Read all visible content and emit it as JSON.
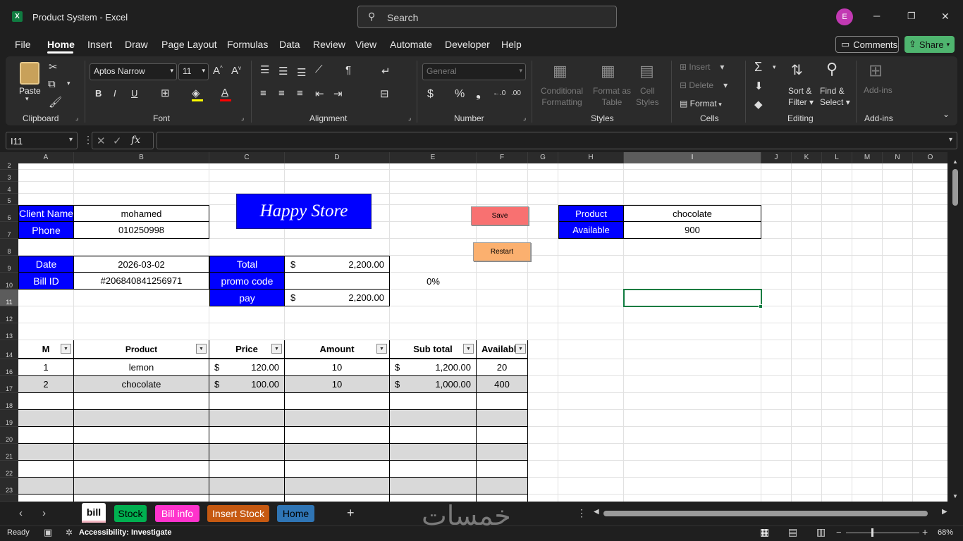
{
  "app": {
    "title": "Product System",
    "app_name": "Excel",
    "search_placeholder": "Search",
    "user_initial": "E"
  },
  "window_controls": {
    "minimize": "─",
    "restore": "❐",
    "close": "✕"
  },
  "menu": [
    "File",
    "Home",
    "Insert",
    "Draw",
    "Page Layout",
    "Formulas",
    "Data",
    "Review",
    "View",
    "Automate",
    "Developer",
    "Help"
  ],
  "actions": {
    "comments": "Comments",
    "share": "Share"
  },
  "ribbon": {
    "clipboard": {
      "paste": "Paste",
      "label": "Clipboard"
    },
    "font": {
      "name": "Aptos Narrow",
      "size": "11",
      "bold": "B",
      "italic": "I",
      "underline": "U",
      "label": "Font"
    },
    "alignment": {
      "label": "Alignment"
    },
    "number": {
      "format": "General",
      "currency": "$",
      "percent": "%",
      "comma": "❟",
      "label": "Number"
    },
    "styles": {
      "conditional_1": "Conditional",
      "conditional_2": "Formatting",
      "format_as_1": "Format as",
      "format_as_2": "Table",
      "cell_1": "Cell",
      "cell_2": "Styles",
      "label": "Styles"
    },
    "cells": {
      "insert": "Insert",
      "delete": "Delete",
      "format": "Format",
      "label": "Cells"
    },
    "editing": {
      "sort_1": "Sort &",
      "sort_2": "Filter",
      "find_1": "Find &",
      "find_2": "Select",
      "label": "Editing"
    },
    "addins": {
      "addins": "Add-ins",
      "label": "Add-ins"
    }
  },
  "formula_bar": {
    "name_box": "I11",
    "fx": "fx",
    "formula": ""
  },
  "columns": [
    "A",
    "B",
    "C",
    "D",
    "E",
    "F",
    "G",
    "H",
    "I",
    "J",
    "K",
    "L",
    "M",
    "N",
    "O"
  ],
  "rows": [
    "2",
    "3",
    "4",
    "5",
    "6",
    "7",
    "8",
    "9",
    "10",
    "11",
    "12",
    "13",
    "14",
    "16",
    "17",
    "18",
    "19",
    "20",
    "21",
    "22",
    "23"
  ],
  "sheet": {
    "logo": "Happy Store",
    "client_name_label": "Client Name",
    "client_name": "mohamed",
    "phone_label": "Phone",
    "phone": "010250998",
    "date_label": "Date",
    "date": "2026-03-02",
    "bill_id_label": "Bill ID",
    "bill_id": "#206840841256971",
    "total_label": "Total",
    "total_currency": "$",
    "total": "2,200.00",
    "promo_label": "promo code",
    "promo": "",
    "discount": "0%",
    "pay_label": "pay",
    "pay_currency": "$",
    "pay": "2,200.00",
    "save_button": "Save",
    "restart_button": "Restart",
    "lookup_product_label": "Product",
    "lookup_product": "chocolate",
    "lookup_available_label": "Available",
    "lookup_available": "900",
    "table_headers": [
      "M",
      "Product",
      "Price",
      "Amount",
      "Sub total",
      "Availabl"
    ],
    "table_rows": [
      {
        "m": "1",
        "product": "lemon",
        "price_cur": "$",
        "price": "120.00",
        "amount": "10",
        "sub_cur": "$",
        "subtotal": "1,200.00",
        "available": "20"
      },
      {
        "m": "2",
        "product": "chocolate",
        "price_cur": "$",
        "price": "100.00",
        "amount": "10",
        "sub_cur": "$",
        "subtotal": "1,000.00",
        "available": "400"
      }
    ]
  },
  "tabs": [
    {
      "label": "bill",
      "color": "#f4b6c2"
    },
    {
      "label": "Stock",
      "color": "#00b050"
    },
    {
      "label": "Bill info",
      "color": "#ff33cc"
    },
    {
      "label": "Insert Stock",
      "color": "#c65911"
    },
    {
      "label": "Home",
      "color": "#2f75b5"
    }
  ],
  "watermark": "خمسات",
  "status": {
    "ready": "Ready",
    "accessibility": "Accessibility: Investigate",
    "zoom": "68%"
  }
}
